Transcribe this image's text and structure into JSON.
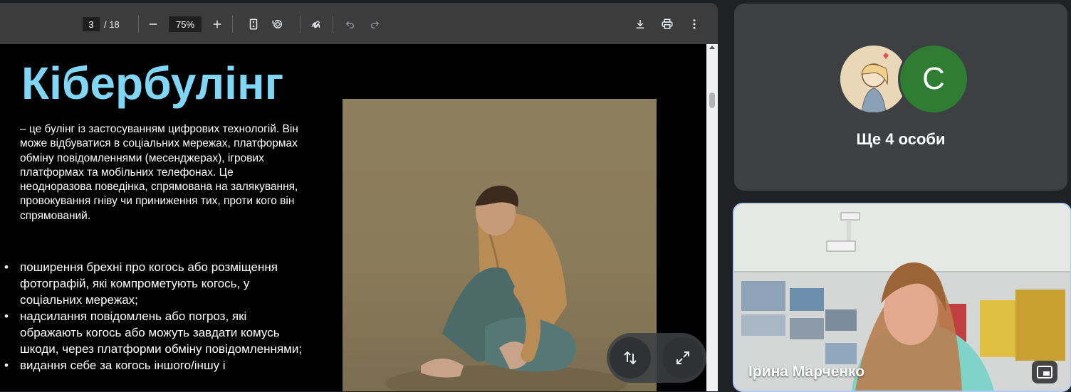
{
  "pdf_viewer": {
    "toolbar": {
      "current_page": "3",
      "total_pages": "/ 18",
      "zoom": "75%",
      "zoom_out_icon": "minus-icon",
      "zoom_in_icon": "plus-icon",
      "fit_page_icon": "fit-page-icon",
      "rotate_icon": "rotate-icon",
      "annotate_icon": "pen-icon",
      "undo_icon": "undo-icon",
      "redo_icon": "redo-icon",
      "download_icon": "download-icon",
      "print_icon": "print-icon",
      "more_icon": "more-vert-icon"
    },
    "slide": {
      "title": "Кібербулінг",
      "intro": "– це булінг із застосуванням цифрових технологій. Він може відбуватися в соціальних мережах, платформах обміну повідомленнями (месенджерах), ігрових платформах та мобільних телефонах. Це неодноразова поведінка, спрямована на залякування, провокування гніву чи приниження тих, проти кого він спрямований.",
      "bullets": [
        "поширення брехні про когось або розміщення фотографій, які компрометують когось, у соціальних мережах;",
        "надсилання повідомлень або погроз, які ображають когось або можуть завдати комусь шкоди, через платформи обміну повідомленнями;",
        "видання себе за когось іншого/іншу і"
      ],
      "title_color": "#7fd6f6"
    },
    "floating_controls": {
      "swap_icon": "swap-vert-icon",
      "expand_icon": "fullscreen-icon"
    }
  },
  "meet": {
    "others_tile": {
      "avatar_letter": "C",
      "label": "Ще 4 особи",
      "avatar_color": "#2e7d32"
    },
    "video_tile": {
      "participant_name": "Ірина Марченко",
      "pip_icon": "picture-in-picture-icon"
    }
  }
}
